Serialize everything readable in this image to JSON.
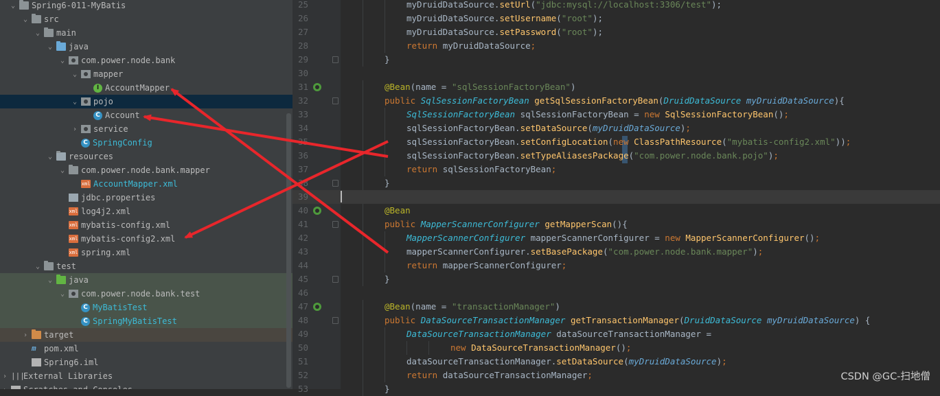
{
  "project_tree": {
    "items": [
      {
        "label": "Spring6-011-MyBatis",
        "depth": 1,
        "chev": "⌄",
        "icon": "folder",
        "icon_name": "module-folder-icon"
      },
      {
        "label": "src",
        "depth": 2,
        "chev": "⌄",
        "icon": "folder",
        "icon_name": "folder-icon"
      },
      {
        "label": "main",
        "depth": 3,
        "chev": "⌄",
        "icon": "folder",
        "icon_name": "folder-icon"
      },
      {
        "label": "java",
        "depth": 4,
        "chev": "⌄",
        "icon": "folder src",
        "icon_name": "source-folder-icon"
      },
      {
        "label": "com.power.node.bank",
        "depth": 5,
        "chev": "⌄",
        "icon": "pkg",
        "icon_name": "package-icon"
      },
      {
        "label": "mapper",
        "depth": 6,
        "chev": "⌄",
        "icon": "pkg",
        "icon_name": "package-icon"
      },
      {
        "label": "AccountMapper",
        "depth": 7,
        "chev": "",
        "icon": "circle iface",
        "glyph": "I",
        "icon_name": "interface-icon"
      },
      {
        "label": "pojo",
        "depth": 6,
        "chev": "⌄",
        "icon": "pkg",
        "icon_name": "package-icon",
        "selected": true
      },
      {
        "label": "Account",
        "depth": 7,
        "chev": "",
        "icon": "circle cls",
        "glyph": "C",
        "icon_name": "class-icon"
      },
      {
        "label": "service",
        "depth": 6,
        "chev": "›",
        "icon": "pkg",
        "icon_name": "package-icon"
      },
      {
        "label": "SpringConfig",
        "depth": 6,
        "chev": "",
        "icon": "circle cls",
        "glyph": "C",
        "icon_name": "class-icon",
        "color": "blue"
      },
      {
        "label": "resources",
        "depth": 4,
        "chev": "⌄",
        "icon": "folder res",
        "icon_name": "resources-folder-icon"
      },
      {
        "label": "com.power.node.bank.mapper",
        "depth": 5,
        "chev": "⌄",
        "icon": "folder",
        "icon_name": "folder-icon"
      },
      {
        "label": "AccountMapper.xml",
        "depth": 6,
        "chev": "",
        "icon": "xmlicon",
        "glyph": "xml",
        "icon_name": "xml-file-icon",
        "color": "blue"
      },
      {
        "label": "jdbc.properties",
        "depth": 5,
        "chev": "",
        "icon": "propsicon",
        "icon_name": "properties-file-icon"
      },
      {
        "label": "log4j2.xml",
        "depth": 5,
        "chev": "",
        "icon": "xmlicon",
        "glyph": "xml",
        "icon_name": "xml-file-icon"
      },
      {
        "label": "mybatis-config.xml",
        "depth": 5,
        "chev": "",
        "icon": "xmlicon",
        "glyph": "xml",
        "icon_name": "xml-file-icon"
      },
      {
        "label": "mybatis-config2.xml",
        "depth": 5,
        "chev": "",
        "icon": "xmlicon",
        "glyph": "xml",
        "icon_name": "xml-file-icon"
      },
      {
        "label": "spring.xml",
        "depth": 5,
        "chev": "",
        "icon": "xmlicon",
        "glyph": "xml",
        "icon_name": "xml-file-icon"
      },
      {
        "label": "test",
        "depth": 3,
        "chev": "⌄",
        "icon": "folder",
        "icon_name": "folder-icon"
      },
      {
        "label": "java",
        "depth": 4,
        "chev": "⌄",
        "icon": "folder test",
        "icon_name": "test-folder-icon",
        "row": "test"
      },
      {
        "label": "com.power.node.bank.test",
        "depth": 5,
        "chev": "⌄",
        "icon": "pkg",
        "icon_name": "package-icon",
        "row": "test"
      },
      {
        "label": "MyBatisTest",
        "depth": 6,
        "chev": "",
        "icon": "circle cls",
        "glyph": "C",
        "icon_name": "test-class-icon",
        "row": "test",
        "color": "blue"
      },
      {
        "label": "SpringMyBatisTest",
        "depth": 6,
        "chev": "",
        "icon": "circle cls",
        "glyph": "C",
        "icon_name": "test-class-icon",
        "row": "test",
        "color": "blue"
      },
      {
        "label": "target",
        "depth": 2,
        "chev": "›",
        "icon": "folder target",
        "icon_name": "excluded-folder-icon",
        "row": "excluded"
      },
      {
        "label": "pom.xml",
        "depth": 2,
        "chev": "",
        "icon": "mvn",
        "glyph": "m",
        "icon_name": "maven-icon"
      },
      {
        "label": "Spring6.iml",
        "depth": 2,
        "chev": "",
        "icon": "fileicon",
        "icon_name": "iml-file-icon"
      },
      {
        "label": "External Libraries",
        "depth": 0,
        "chev": "›",
        "icon": "libicon",
        "glyph": "|||",
        "icon_name": "libraries-icon"
      },
      {
        "label": "Scratches and Consoles",
        "depth": 0,
        "chev": "›",
        "icon": "fileicon",
        "icon_name": "scratches-icon"
      }
    ]
  },
  "editor": {
    "lines": [
      {
        "n": "25",
        "indent": 2,
        "tokens": [
          [
            "t",
            "myDruidDataSource."
          ],
          [
            "m",
            "setUrl"
          ],
          [
            "t",
            "("
          ],
          [
            "s",
            "\"jdbc:mysql://localhost:3306/test\""
          ],
          [
            "t",
            ");"
          ]
        ]
      },
      {
        "n": "26",
        "indent": 2,
        "tokens": [
          [
            "t",
            "myDruidDataSource."
          ],
          [
            "m",
            "setUsername"
          ],
          [
            "t",
            "("
          ],
          [
            "s",
            "\"root\""
          ],
          [
            "t",
            ");"
          ]
        ]
      },
      {
        "n": "27",
        "indent": 2,
        "tokens": [
          [
            "t",
            "myDruidDataSource."
          ],
          [
            "m",
            "setPassword"
          ],
          [
            "t",
            "("
          ],
          [
            "s",
            "\"root\""
          ],
          [
            "t",
            ");"
          ]
        ]
      },
      {
        "n": "28",
        "indent": 2,
        "tokens": [
          [
            "k",
            "return "
          ],
          [
            "t",
            "myDruidDataSource"
          ],
          [
            "k",
            ";"
          ]
        ]
      },
      {
        "n": "29",
        "indent": 1,
        "fold": true,
        "tokens": [
          [
            "t",
            "}"
          ]
        ]
      },
      {
        "n": "30",
        "indent": 0,
        "tokens": []
      },
      {
        "n": "31",
        "indent": 1,
        "bean": true,
        "tokens": [
          [
            "a",
            "@Bean"
          ],
          [
            "t",
            "(name = "
          ],
          [
            "s",
            "\"sqlSessionFactoryBean\""
          ],
          [
            "t",
            ")"
          ]
        ]
      },
      {
        "n": "32",
        "indent": 1,
        "fold": true,
        "tokens": [
          [
            "k",
            "public "
          ],
          [
            "y",
            "SqlSessionFactoryBean "
          ],
          [
            "m",
            "getSqlSessionFactoryBean"
          ],
          [
            "t",
            "("
          ],
          [
            "y",
            "DruidDataSource "
          ],
          [
            "p",
            "myDruidDataSource"
          ],
          [
            "t",
            "){"
          ]
        ]
      },
      {
        "n": "33",
        "indent": 2,
        "tokens": [
          [
            "y",
            "SqlSessionFactoryBean "
          ],
          [
            "t",
            "sqlSessionFactoryBean = "
          ],
          [
            "k",
            "new "
          ],
          [
            "m",
            "SqlSessionFactoryBean"
          ],
          [
            "t",
            "()"
          ],
          [
            "k",
            ";"
          ]
        ]
      },
      {
        "n": "34",
        "indent": 2,
        "tokens": [
          [
            "t",
            "sqlSessionFactoryBean."
          ],
          [
            "m",
            "setDataSource"
          ],
          [
            "t",
            "("
          ],
          [
            "p",
            "myDruidDataSource"
          ],
          [
            "t",
            ")"
          ],
          [
            "k",
            ";"
          ]
        ]
      },
      {
        "n": "35",
        "indent": 2,
        "tokens": [
          [
            "t",
            "sqlSessionFactoryBean."
          ],
          [
            "m",
            "setConfigLocation"
          ],
          [
            "t",
            "("
          ],
          [
            "k",
            "new "
          ],
          [
            "m",
            "ClassPathResource"
          ],
          [
            "t",
            "("
          ],
          [
            "s",
            "\"mybatis-config2.xml\""
          ],
          [
            "t",
            "))"
          ],
          [
            "k",
            ";"
          ]
        ]
      },
      {
        "n": "36",
        "indent": 2,
        "tokens": [
          [
            "t",
            "sqlSessionFactoryBean."
          ],
          [
            "m",
            "setTypeAliasesPackage"
          ],
          [
            "t",
            "("
          ],
          [
            "s",
            "\"com.power.node.bank.pojo\""
          ],
          [
            "t",
            ")"
          ],
          [
            "k",
            ";"
          ]
        ]
      },
      {
        "n": "37",
        "indent": 2,
        "tokens": [
          [
            "k",
            "return "
          ],
          [
            "t",
            "sqlSessionFactoryBean"
          ],
          [
            "k",
            ";"
          ]
        ]
      },
      {
        "n": "38",
        "indent": 1,
        "fold": true,
        "tokens": [
          [
            "t",
            "}"
          ]
        ]
      },
      {
        "n": "39",
        "indent": 0,
        "current": true,
        "tokens": []
      },
      {
        "n": "40",
        "indent": 1,
        "bean": true,
        "tokens": [
          [
            "a",
            "@Bean"
          ]
        ]
      },
      {
        "n": "41",
        "indent": 1,
        "fold": true,
        "tokens": [
          [
            "k",
            "public "
          ],
          [
            "y",
            "MapperScannerConfigurer "
          ],
          [
            "m",
            "getMapperScan"
          ],
          [
            "t",
            "(){"
          ]
        ]
      },
      {
        "n": "42",
        "indent": 2,
        "tokens": [
          [
            "y",
            "MapperScannerConfigurer "
          ],
          [
            "t",
            "mapperScannerConfigurer = "
          ],
          [
            "k",
            "new "
          ],
          [
            "m",
            "MapperScannerConfigurer"
          ],
          [
            "t",
            "()"
          ],
          [
            "k",
            ";"
          ]
        ]
      },
      {
        "n": "43",
        "indent": 2,
        "tokens": [
          [
            "t",
            "mapperScannerConfigurer."
          ],
          [
            "m",
            "setBasePackage"
          ],
          [
            "t",
            "("
          ],
          [
            "s",
            "\"com.power.node.bank.mapper\""
          ],
          [
            "t",
            ")"
          ],
          [
            "k",
            ";"
          ]
        ]
      },
      {
        "n": "44",
        "indent": 2,
        "tokens": [
          [
            "k",
            "return "
          ],
          [
            "t",
            "mapperScannerConfigurer"
          ],
          [
            "k",
            ";"
          ]
        ]
      },
      {
        "n": "45",
        "indent": 1,
        "fold": true,
        "tokens": [
          [
            "t",
            "}"
          ]
        ]
      },
      {
        "n": "46",
        "indent": 0,
        "tokens": []
      },
      {
        "n": "47",
        "indent": 1,
        "bean": true,
        "tokens": [
          [
            "a",
            "@Bean"
          ],
          [
            "t",
            "(name = "
          ],
          [
            "s",
            "\"transactionManager\""
          ],
          [
            "t",
            ")"
          ]
        ]
      },
      {
        "n": "48",
        "indent": 1,
        "fold": true,
        "tokens": [
          [
            "k",
            "public "
          ],
          [
            "y",
            "DataSourceTransactionManager "
          ],
          [
            "m",
            "getTransactionManager"
          ],
          [
            "t",
            "("
          ],
          [
            "y",
            "DruidDataSource "
          ],
          [
            "p",
            "myDruidDataSource"
          ],
          [
            "t",
            ") {"
          ]
        ]
      },
      {
        "n": "49",
        "indent": 2,
        "tokens": [
          [
            "y",
            "DataSourceTransactionManager "
          ],
          [
            "t",
            "dataSourceTransactionManager = "
          ]
        ]
      },
      {
        "n": "50",
        "indent": 4,
        "tokens": [
          [
            "k",
            "new "
          ],
          [
            "m",
            "DataSourceTransactionManager"
          ],
          [
            "t",
            "()"
          ],
          [
            "k",
            ";"
          ]
        ]
      },
      {
        "n": "51",
        "indent": 2,
        "tokens": [
          [
            "t",
            "dataSourceTransactionManager."
          ],
          [
            "m",
            "setDataSource"
          ],
          [
            "t",
            "("
          ],
          [
            "p",
            "myDruidDataSource"
          ],
          [
            "t",
            ")"
          ],
          [
            "k",
            ";"
          ]
        ]
      },
      {
        "n": "52",
        "indent": 2,
        "tokens": [
          [
            "k",
            "return "
          ],
          [
            "t",
            "dataSourceTransactionManager"
          ],
          [
            "k",
            ";"
          ]
        ]
      },
      {
        "n": "53",
        "indent": 1,
        "tokens": [
          [
            "t",
            "}"
          ]
        ]
      }
    ]
  },
  "watermark": "CSDN @GC-扫地僧",
  "colors": {
    "annotation_arrow": "#e8262b",
    "selection": "#0d293e"
  }
}
